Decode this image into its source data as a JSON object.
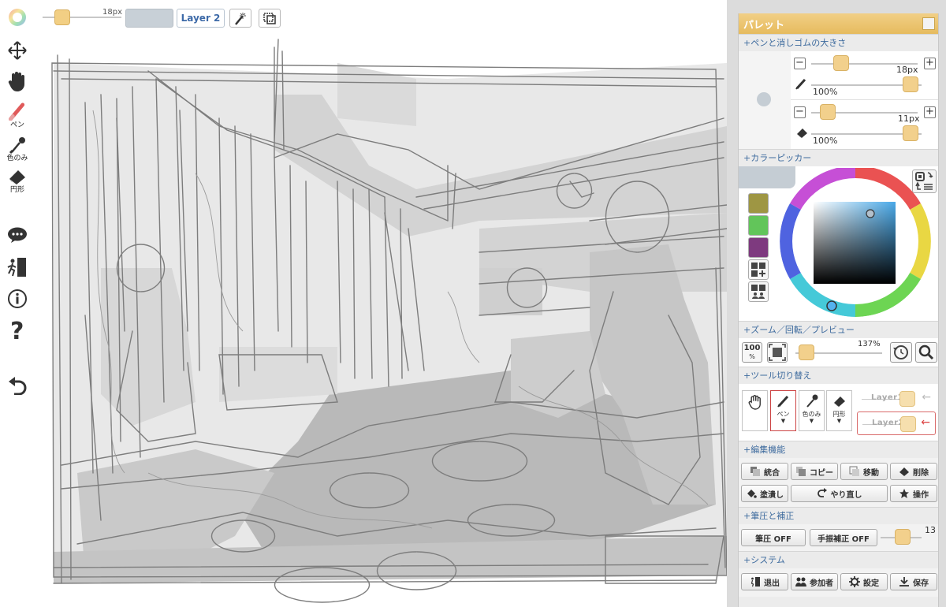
{
  "topbar": {
    "brush_size": "18px",
    "layer_button": "Layer 2",
    "swatch_color": "#c8d0d7"
  },
  "left_toolbar": {
    "pen_label": "ペン",
    "eyedropper_label": "色のみ",
    "eraser_label": "円形"
  },
  "palette": {
    "title": "パレット",
    "sections": {
      "size": "+ペンと消しゴムの大きさ",
      "color_picker": "+カラーピッカー",
      "zoom": "+ズーム／回転／プレビュー",
      "tool_switch": "+ツール切り替え",
      "edit": "+編集機能",
      "pressure": "+筆圧と補正",
      "system": "+システム"
    },
    "pen": {
      "size": "18px",
      "opacity": "100%"
    },
    "eraser": {
      "size": "11px",
      "opacity": "100%"
    },
    "colors": {
      "current": "#c5cdd4",
      "swatches": [
        "#9e9643",
        "#62c55a",
        "#7e3a7f"
      ],
      "hue_ring_selected": "#54b2ee"
    },
    "zoom": {
      "reset_label": "100",
      "reset_unit": "%",
      "value": "137%"
    },
    "tools": {
      "pen_label": "ペン",
      "eyedropper_label": "色のみ",
      "eraser_label": "円形",
      "arrow": "▼"
    },
    "layers": [
      {
        "name": "Layer1",
        "active": false
      },
      {
        "name": "Layer2",
        "active": true
      }
    ],
    "edit_buttons": {
      "merge": "統合",
      "copy": "コピー",
      "move": "移動",
      "delete": "削除",
      "fill": "塗潰し",
      "redo": "やり直し",
      "operate": "操作"
    },
    "pressure": {
      "pressure_btn": "筆圧 OFF",
      "stabilizer_btn": "手振補正 OFF",
      "stabilizer_value": "13"
    },
    "system_buttons": {
      "exit": "退出",
      "participants": "参加者",
      "settings": "設定",
      "save": "保存"
    }
  }
}
